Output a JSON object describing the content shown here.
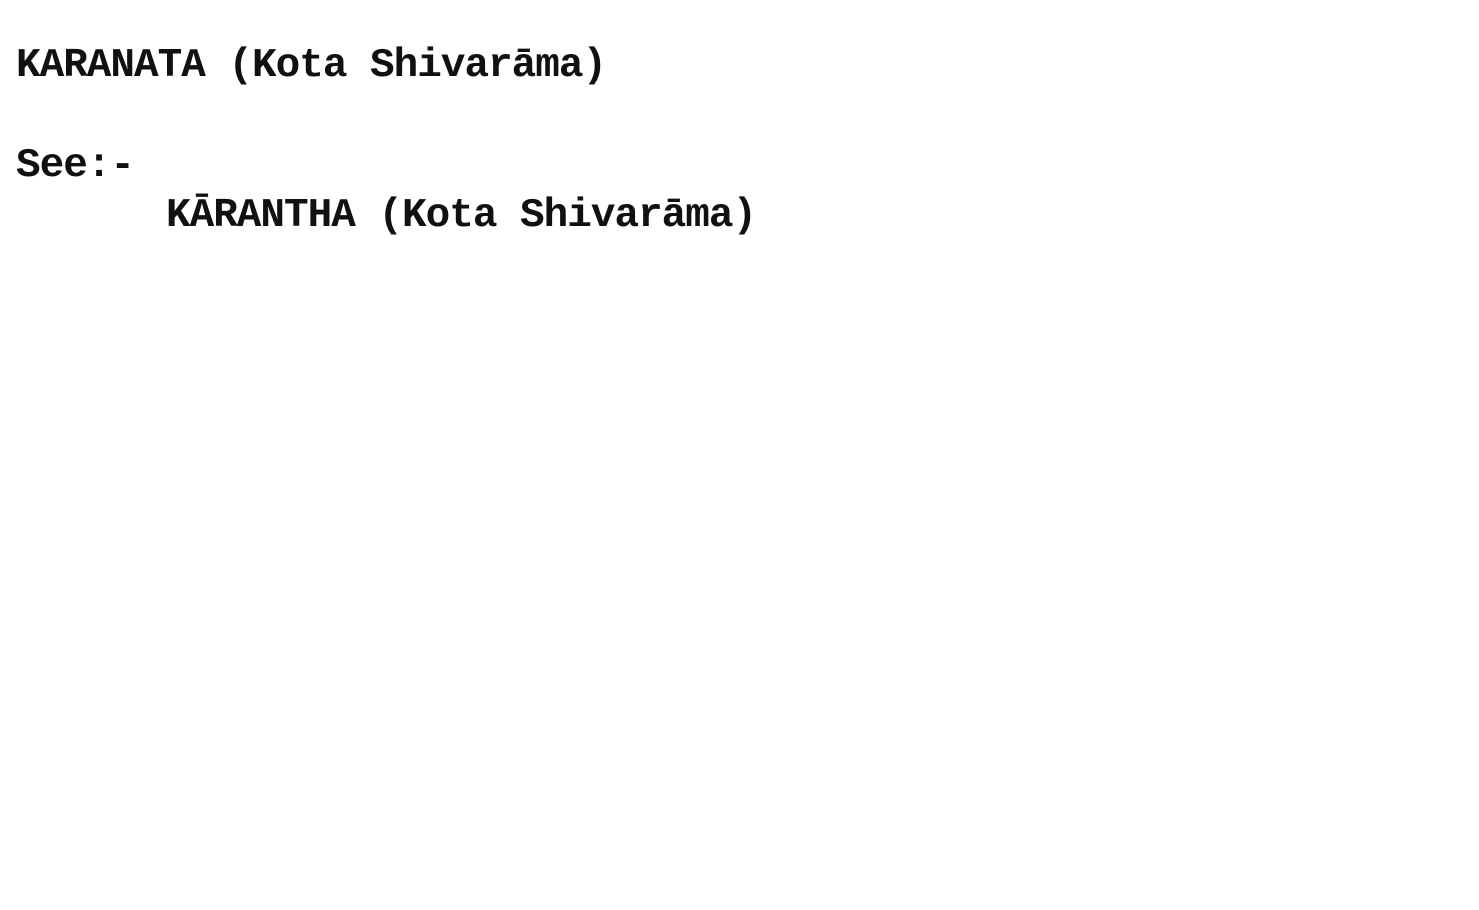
{
  "card": {
    "heading": "KARANATA (Kota Shivarāma)",
    "see_label": "See:-",
    "see_reference": "KĀRANTHA (Kota Shivarāma)"
  }
}
